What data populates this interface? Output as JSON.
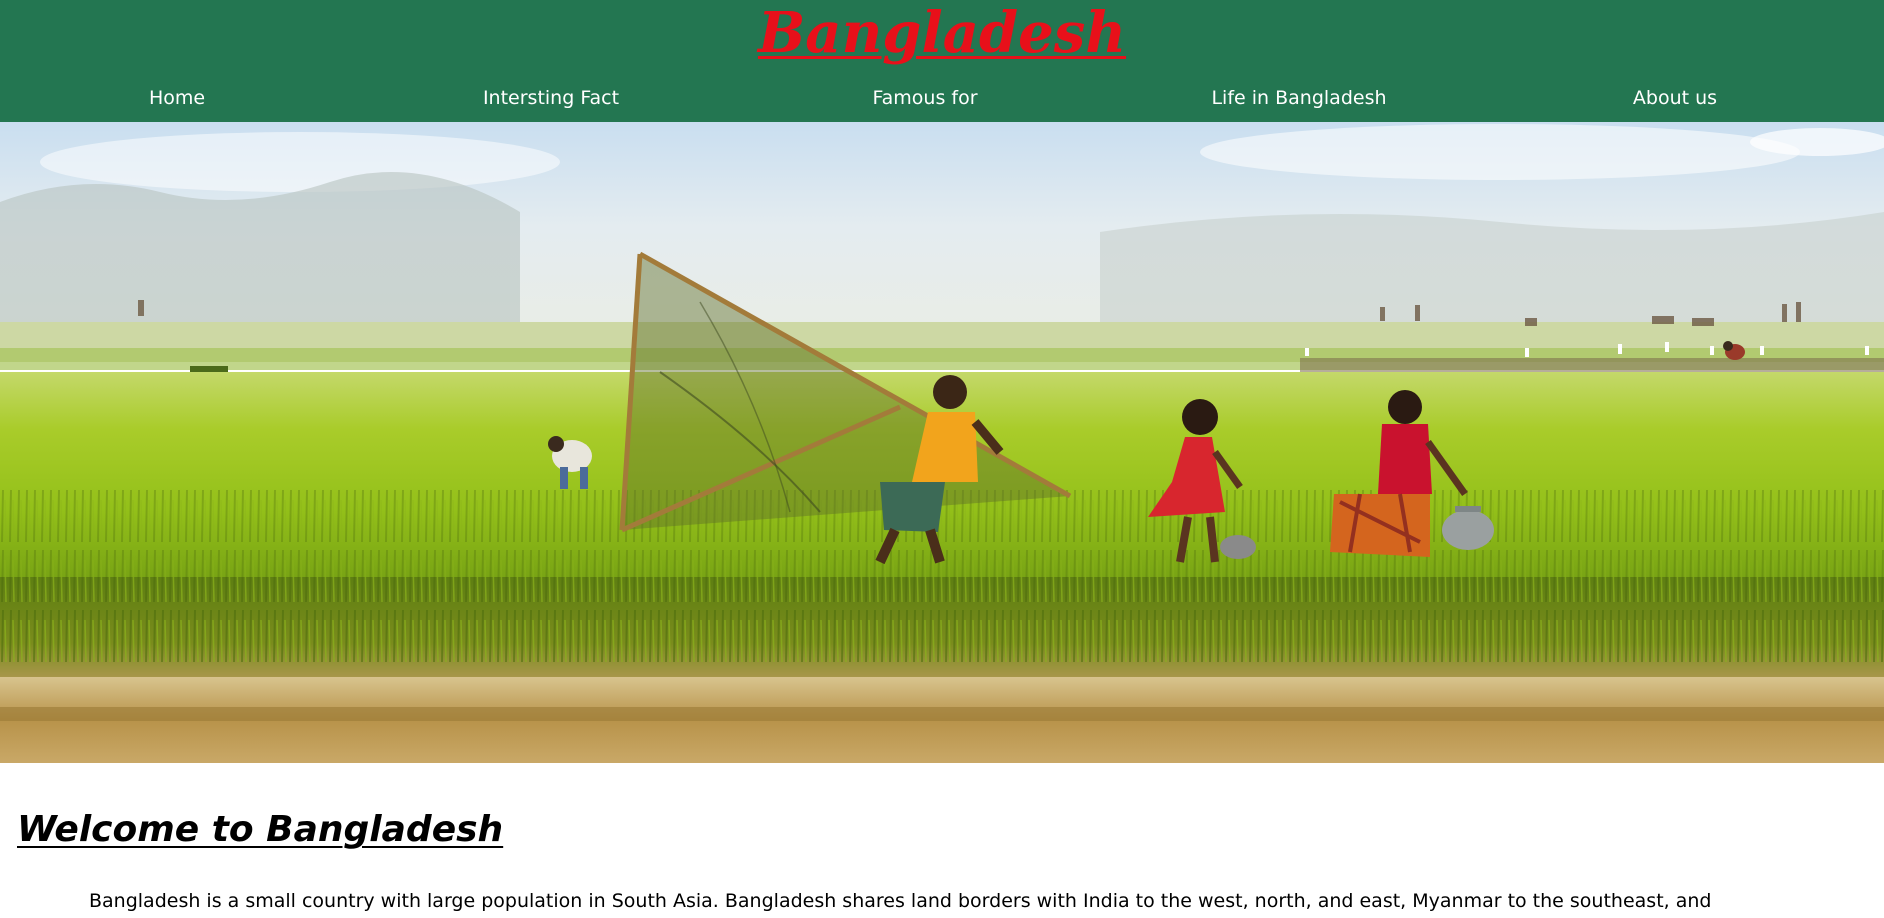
{
  "site": {
    "title": "Bangladesh"
  },
  "nav": {
    "items": [
      {
        "label": "Home"
      },
      {
        "label": "Intersting Fact"
      },
      {
        "label": "Famous for"
      },
      {
        "label": "Life in Bangladesh"
      },
      {
        "label": "About us"
      }
    ]
  },
  "hero": {
    "subject": "rice-field-children-photo"
  },
  "main": {
    "heading": "Welcome to Bangladesh",
    "intro": "Bangladesh is a small country with large population in South Asia. Bangladesh shares land borders with India to the west, north, and east, Myanmar to the southeast, and"
  },
  "colors": {
    "header_bg": "#237651",
    "title": "#e8101a",
    "nav_text": "#ffffff"
  }
}
